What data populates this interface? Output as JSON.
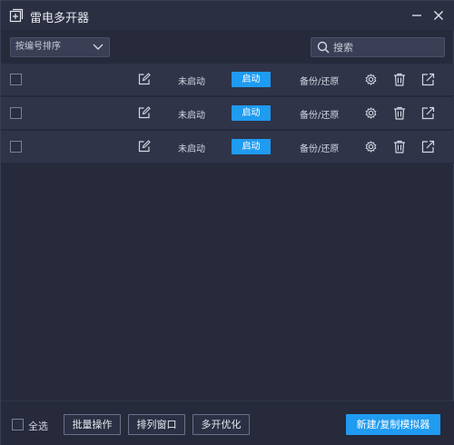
{
  "window": {
    "title": "雷电多开器"
  },
  "toolbar": {
    "sort_value": "按编号排序",
    "search_placeholder": "搜索"
  },
  "rows": [
    {
      "status": "未启动",
      "start_label": "启动",
      "backup_label": "备份/还原"
    },
    {
      "status": "未启动",
      "start_label": "启动",
      "backup_label": "备份/还原"
    },
    {
      "status": "未启动",
      "start_label": "启动",
      "backup_label": "备份/还原"
    }
  ],
  "footer": {
    "select_all": "全选",
    "batch": "批量操作",
    "arrange": "排列窗口",
    "optimize": "多开优化",
    "new_emulator": "新建/复制模拟器"
  },
  "colors": {
    "background": "#262a3b",
    "row": "#2f3449",
    "accent": "#1f9bf0"
  },
  "icons": [
    "app-plus-icon",
    "minimize-icon",
    "close-icon",
    "chevron-down-icon",
    "search-icon",
    "edit-icon",
    "gear-icon",
    "trash-icon",
    "share-icon"
  ]
}
